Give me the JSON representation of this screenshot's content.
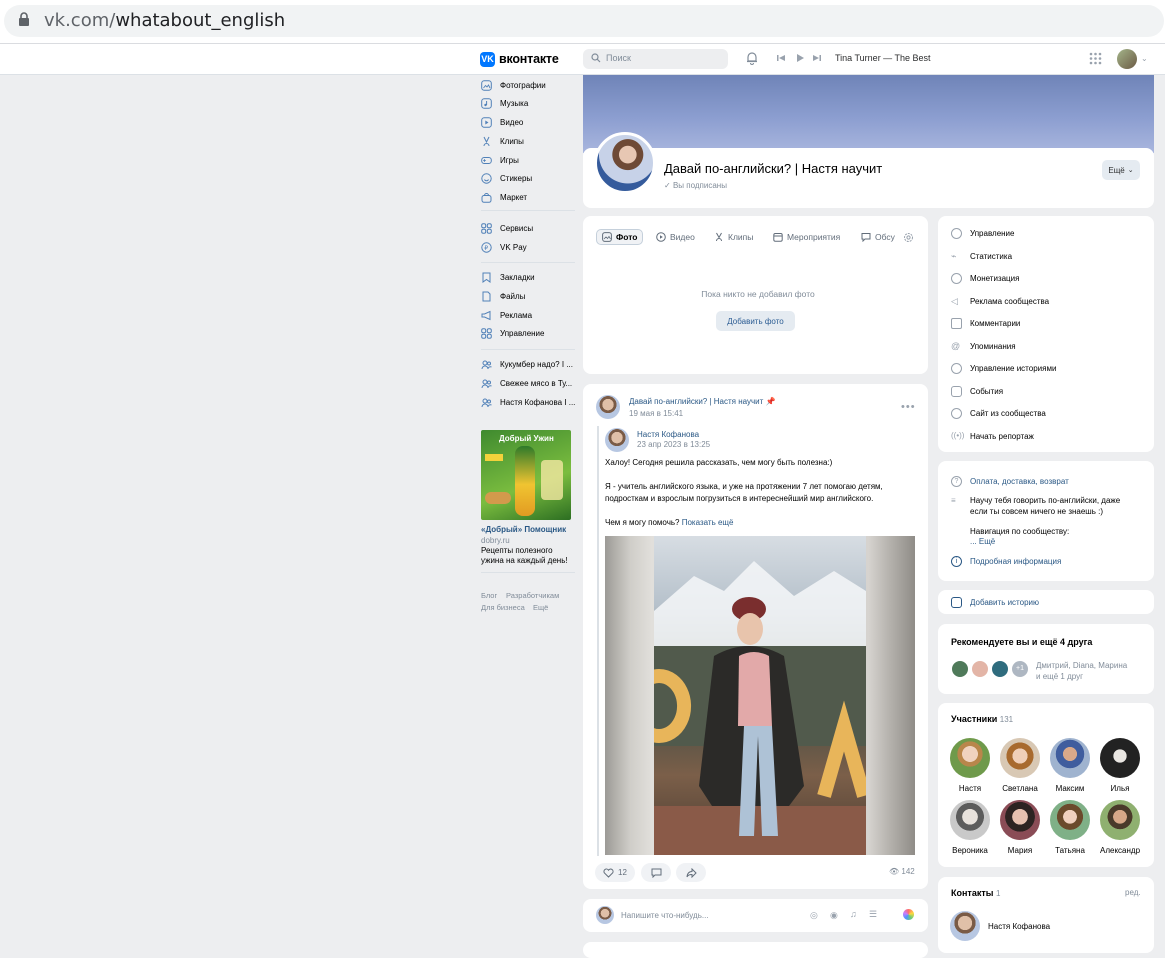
{
  "browser": {
    "url_domain": "vk.com/",
    "url_path": "whatabout_english"
  },
  "header": {
    "logo_text": "вконтакте",
    "search_placeholder": "Поиск",
    "track": "Tina Turner — The Best"
  },
  "left_nav": {
    "group1": [
      "Фотографии",
      "Музыка",
      "Видео",
      "Клипы",
      "Игры",
      "Стикеры",
      "Маркет"
    ],
    "group2": [
      "Сервисы",
      "VK Pay"
    ],
    "group3": [
      "Закладки",
      "Файлы",
      "Реклама",
      "Управление"
    ],
    "group4": [
      "Кукумбер надо? I ...",
      "Свежее мясо в Ту...",
      "Настя Кофанова I ..."
    ]
  },
  "ad": {
    "image_heading": "Добрый Ужин",
    "title": "«Добрый» Помощник",
    "domain": "dobry.ru",
    "description": "Рецепты полезного ужина на каждый день!"
  },
  "footer_links": [
    "Блог",
    "Разработчикам",
    "Для бизнеса",
    "Ещё"
  ],
  "group": {
    "title": "Давай по-английски? | Настя научит",
    "subscribed": "Вы подписаны",
    "more_button": "Ещё"
  },
  "media_tabs": [
    "Фото",
    "Видео",
    "Клипы",
    "Мероприятия",
    "Обсу"
  ],
  "photos_empty": {
    "text": "Пока никто не добавил фото",
    "button": "Добавить фото"
  },
  "post": {
    "group_name": "Давай по-английски? | Настя научит",
    "date": "19 мая в 15:41",
    "repost_author": "Настя Кофанова",
    "repost_date": "23 апр 2023 в 13:25",
    "paragraph1": "Халоу! Сегодня решила рассказать, чем могу быть полезна:)",
    "paragraph2a": "Я - учитель английского языка, и уже на протяжении 7 лет помогаю детям,",
    "paragraph2b": "подросткам и взрослым погрузиться в интереснейший мир английского.",
    "paragraph3": "Чем я могу помочь?",
    "show_more": "Показать ещё",
    "likes": "12",
    "views": "142"
  },
  "composer": {
    "placeholder": "Напишите что-нибудь..."
  },
  "manage_menu": [
    "Управление",
    "Статистика",
    "Монетизация",
    "Реклама сообщества",
    "Комментарии",
    "Упоминания",
    "Управление историями",
    "События",
    "Сайт из сообщества",
    "Начать репортаж"
  ],
  "info": {
    "delivery": "Оплата, доставка, возврат",
    "description_line1": "Научу тебя говорить по-английски, даже",
    "description_line2": "если ты совсем ничего не знаешь :)",
    "navigation": "Навигация по сообществу:",
    "more": "... Ещё",
    "detailed": "Подробная информация"
  },
  "add_story": "Добавить историю",
  "recommend": {
    "title": "Рекомендуете вы и ещё 4 друга",
    "plus": "+1",
    "names_line1": "Дмитрий, Diana, Марина",
    "names_line2": "и ещё 1 друг"
  },
  "members": {
    "title": "Участники",
    "count": "131",
    "names": [
      "Настя",
      "Светлана",
      "Максим",
      "Илья",
      "Вероника",
      "Мария",
      "Татьяна",
      "Александр"
    ]
  },
  "contacts": {
    "title": "Контакты",
    "count": "1",
    "edit": "ред.",
    "name": "Настя Кофанова"
  },
  "colors": {
    "accent": "#0077ff",
    "link": "#2a5885",
    "background": "#edeef0"
  }
}
